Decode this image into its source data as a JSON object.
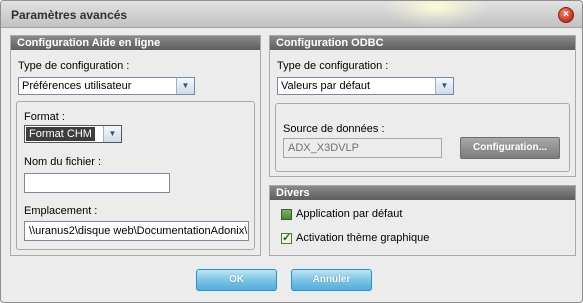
{
  "window": {
    "title": "Paramètres avancés",
    "close_glyph": "×"
  },
  "help_group": {
    "header": "Configuration Aide en ligne",
    "config_type_label": "Type de configuration :",
    "config_type_value": "Préférences utilisateur",
    "format_label": "Format :",
    "format_value": "Format CHM",
    "filename_label": "Nom du fichier :",
    "filename_value": "",
    "location_label": "Emplacement :",
    "location_value": "\\\\uranus2\\disque web\\DocumentationAdonix\\"
  },
  "odbc_group": {
    "header": "Configuration ODBC",
    "config_type_label": "Type de configuration :",
    "config_type_value": "Valeurs par défaut",
    "datasource_label": "Source de données :",
    "datasource_value": "ADX_X3DVLP",
    "config_button": "Configuration..."
  },
  "misc_group": {
    "header": "Divers",
    "default_app_label": "Application par défaut",
    "default_app_checked": false,
    "theme_label": "Activation thème graphique",
    "theme_checked": true
  },
  "buttons": {
    "ok": "OK",
    "cancel": "Annuler"
  },
  "icons": {
    "dropdown": "▼"
  }
}
